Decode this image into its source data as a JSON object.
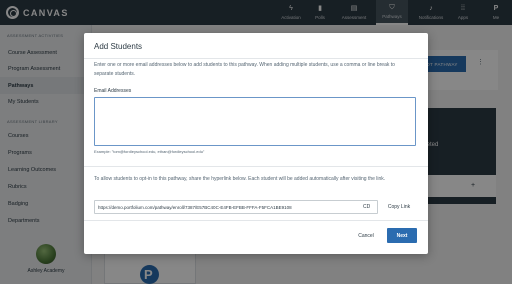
{
  "app": {
    "name": "CANVAS"
  },
  "nav": {
    "items": [
      {
        "label": "Activation",
        "icon": "lightning-icon"
      },
      {
        "label": "Polls",
        "icon": "bar-chart-icon"
      },
      {
        "label": "Assessment",
        "icon": "clipboard-icon"
      },
      {
        "label": "Pathways",
        "icon": "pathways-icon",
        "active": true
      },
      {
        "label": "Notifications",
        "icon": "bell-icon"
      },
      {
        "label": "Apps",
        "icon": "apps-grid-icon"
      },
      {
        "label": "Me",
        "icon": "user-p-icon"
      }
    ]
  },
  "sidebar": {
    "section1": "ASSESSMENT ACTIVITIES",
    "items1": [
      "Course Assessment",
      "Program Assessment",
      "Pathways",
      "My Students"
    ],
    "active_item": "Pathways",
    "section2": "ASSESSMENT LIBRARY",
    "items2": [
      "Courses",
      "Programs",
      "Learning Outcomes",
      "Rubrics",
      "Badging",
      "Departments"
    ],
    "institution": "Ashley Academy"
  },
  "background": {
    "button_label": "OT PATHWAY",
    "panel_text": "pleted"
  },
  "modal": {
    "title": "Add Students",
    "intro": "Enter one or more email addresses below to add students to this pathway. When adding multiple students, use a comma or line break to separate students.",
    "email_label": "Email Addresses",
    "email_value": "",
    "example": "Example: \"tom@fordleyschool.edu, ethan@fordleyschool.edu\"",
    "optin_text": "To allow students to opt-in to this pathway, share the hyperlink below. Each student will be added automatically after visiting the link.",
    "link_url": "https://demo.portfolium.com/pathway/enroll/7387/E57BC40C-E4FB-EFBB-FFFA-F5FCA1BE9108",
    "copy_icon": "copy-icon",
    "copy_label": "Copy Link",
    "cancel_label": "Cancel",
    "next_label": "Next"
  },
  "colors": {
    "nav_bg": "#2d3b45",
    "primary": "#2b6cb0",
    "overlay": "rgba(0,0,0,0.47)"
  }
}
